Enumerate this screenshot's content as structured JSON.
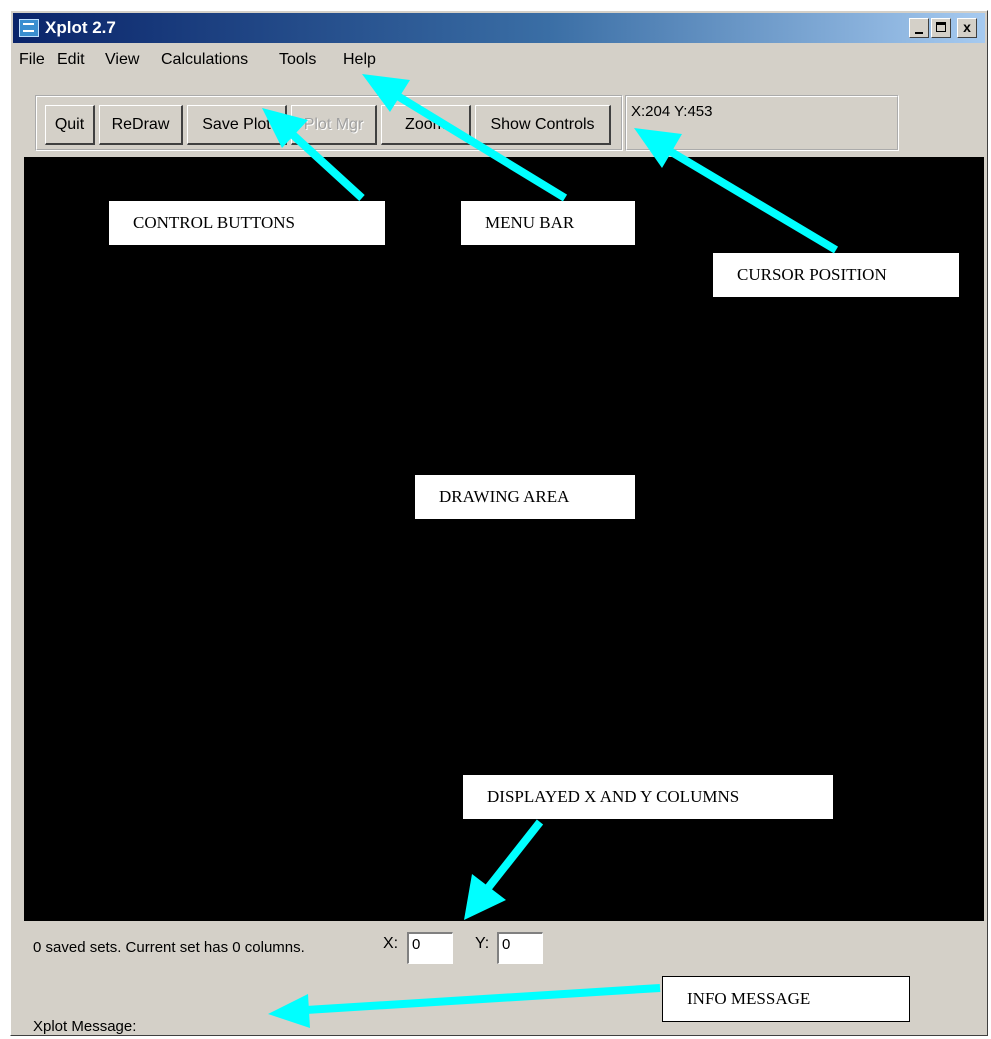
{
  "window": {
    "title": "Xplot 2.7",
    "controls": {
      "minimize": "",
      "maximize": "",
      "close": "x"
    }
  },
  "menu": [
    "File",
    "Edit",
    "View",
    "Calculations",
    "Tools",
    "Help"
  ],
  "toolbar": {
    "buttons": [
      {
        "label": "Quit",
        "enabled": true
      },
      {
        "label": "ReDraw",
        "enabled": true
      },
      {
        "label": "Save Plot",
        "enabled": true
      },
      {
        "label": "Plot Mgr",
        "enabled": false
      },
      {
        "label": "Zoom",
        "enabled": true
      },
      {
        "label": "Show Controls",
        "enabled": true
      }
    ]
  },
  "cursor_position": "X:204 Y:453",
  "status": {
    "sets_text": "0 saved sets. Current set has  0  columns.",
    "x_label": "X:",
    "x_value": "0",
    "y_label": "Y:",
    "y_value": "0",
    "message_label": "Xplot Message:"
  },
  "annotations": {
    "control_buttons": "CONTROL BUTTONS",
    "menu_bar": "MENU BAR",
    "cursor_position": "CURSOR POSITION",
    "drawing_area": "DRAWING AREA",
    "displayed_columns": "DISPLAYED X AND Y COLUMNS",
    "info_message": "INFO  MESSAGE"
  },
  "colors": {
    "arrow": "#00ffff",
    "drawing_background": "#000000",
    "window_face": "#d4d0c8",
    "titlebar_start": "#0a246a"
  }
}
